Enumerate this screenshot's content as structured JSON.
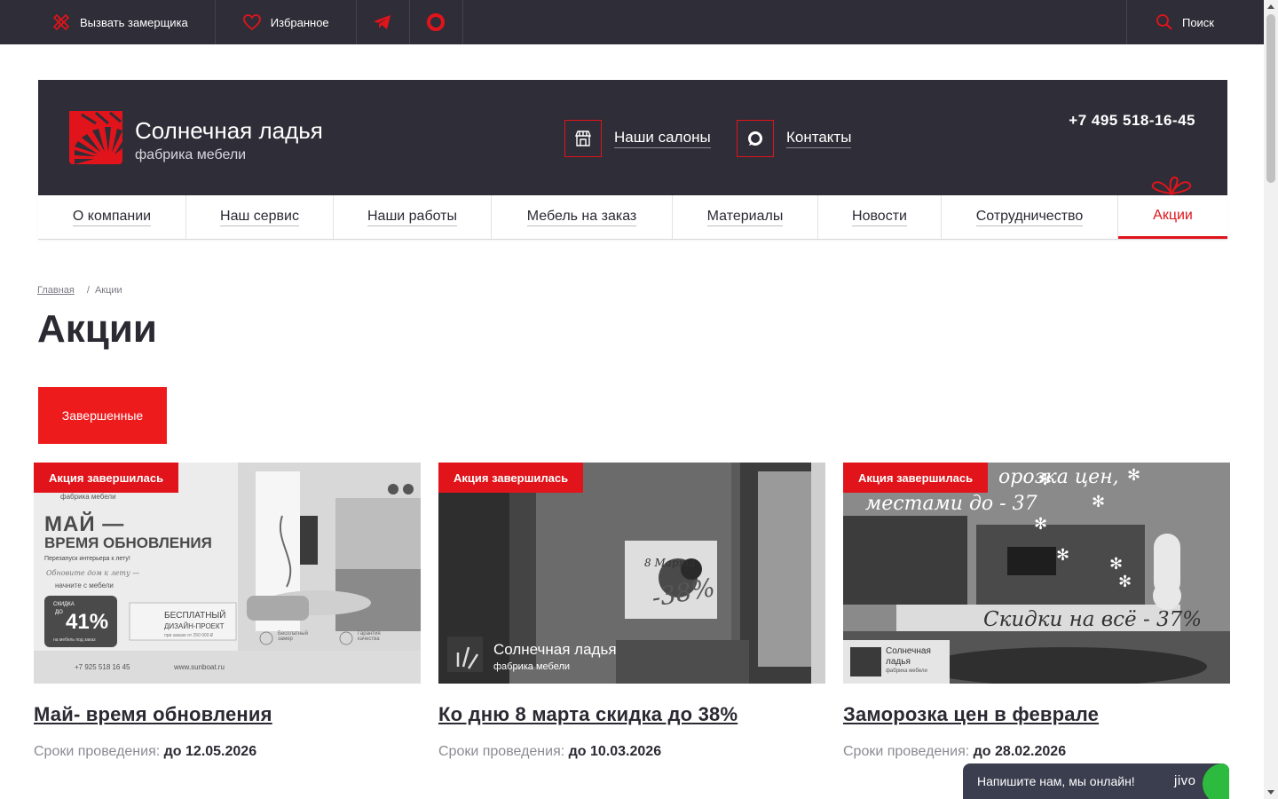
{
  "topbar": {
    "measure_label": "Вызвать замерщика",
    "favorites_label": "Избранное",
    "search_label": "Поиск"
  },
  "header": {
    "brand_name": "Солнечная ладья",
    "brand_sub": "фабрика мебели",
    "salons_label": "Наши салоны",
    "contacts_label": "Контакты",
    "phone": "+7 495 518-16-45"
  },
  "nav": [
    {
      "label": "О компании"
    },
    {
      "label": "Наш сервис"
    },
    {
      "label": "Наши работы"
    },
    {
      "label": "Мебель на заказ"
    },
    {
      "label": "Материалы"
    },
    {
      "label": "Новости"
    },
    {
      "label": "Сотрудничество"
    },
    {
      "label": "Акции",
      "active": true
    }
  ],
  "breadcrumb": {
    "home": "Главная",
    "separator": "/",
    "current": "Акции"
  },
  "page_title": "Акции",
  "filter_tab": "Завершенные",
  "cards": [
    {
      "badge": "Акция завершилась",
      "title": "Май- время обновления",
      "dates_label": "Сроки проведения:",
      "dates_value": "до 12.05.2026",
      "image": {
        "brand": "фабрика мебели",
        "headline1": "МАЙ —",
        "headline2": "ВРЕМЯ ОБНОВЛЕНИЯ",
        "sub": "Перезапуск интерьера к лету!",
        "script": "Обновите дом к лету —",
        "script2": "начните с мебели",
        "discount_label": "СКИДКА",
        "discount_to": "ДО",
        "discount_value": "41%",
        "discount_note": "на мебель под заказ",
        "free1": "БЕСПЛАТНЫЙ",
        "free2": "ДИЗАЙН-ПРОЕКТ",
        "free_note": "при заказе от 250 000 ₽",
        "feat1": "Бесплатный замер",
        "feat2": "Гарантия качества",
        "phone": "+7 925 518 16 45",
        "site": "www.sunboat.ru"
      }
    },
    {
      "badge": "Акция завершилась",
      "title": "Ко дню 8 марта скидка до 38%",
      "dates_label": "Сроки проведения:",
      "dates_value": "до 10.03.2026",
      "image": {
        "tv_text": "8 Марта",
        "tv_discount": "-38%",
        "brand_name": "Солнечная ладья",
        "brand_sub": "фабрика мебели"
      }
    },
    {
      "badge": "Акция завершилась",
      "title": "Заморозка цен в феврале",
      "dates_label": "Сроки проведения:",
      "dates_value": "до 28.02.2026",
      "image": {
        "line1": "орозка цен,",
        "line2": "местами до - 37",
        "line3": "Скидки на всё - 37%",
        "brand_name1": "Солнечная",
        "brand_name2": "ладья",
        "brand_sub": "фабрика мебели"
      }
    }
  ],
  "chat": {
    "label": "Напишите нам, мы онлайн!",
    "brand": "jivo"
  },
  "colors": {
    "accent": "#e1141b",
    "dark": "#2f2d37",
    "text": "#2b2a33",
    "muted": "#8c8b92"
  }
}
